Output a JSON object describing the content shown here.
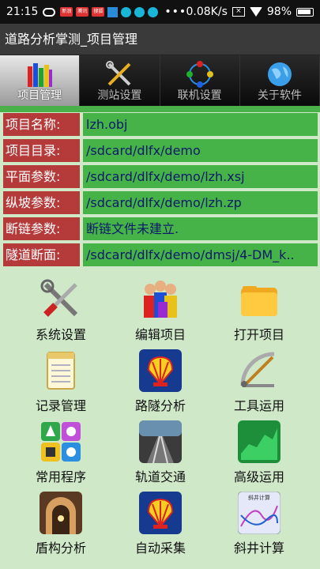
{
  "status": {
    "time": "21:15",
    "speed": "0.08K/s",
    "battery": "98%",
    "badges": [
      "新浪",
      "腾讯",
      "搜狐"
    ]
  },
  "title": "道路分析掌测_项目管理",
  "tabs": [
    {
      "label": "项目管理",
      "icon": "books-icon"
    },
    {
      "label": "测站设置",
      "icon": "tools-icon"
    },
    {
      "label": "联机设置",
      "icon": "network-icon"
    },
    {
      "label": "关于软件",
      "icon": "globe-icon"
    }
  ],
  "info": [
    {
      "label": "项目名称:",
      "value": "lzh.obj"
    },
    {
      "label": "项目目录:",
      "value": "/sdcard/dlfx/demo"
    },
    {
      "label": "平面参数:",
      "value": "/sdcard/dlfx/demo/lzh.xsj"
    },
    {
      "label": "纵坡参数:",
      "value": "/sdcard/dlfx/demo/lzh.zp"
    },
    {
      "label": "断链参数:",
      "value": "断链文件未建立."
    },
    {
      "label": "隧道断面:",
      "value": "/sdcard/dlfx/demo/dmsj/4-DM_k.."
    }
  ],
  "grid": [
    {
      "label": "系统设置",
      "icon": "wrench-screwdriver-icon"
    },
    {
      "label": "编辑项目",
      "icon": "people-icon"
    },
    {
      "label": "打开项目",
      "icon": "folder-icon"
    },
    {
      "label": "记录管理",
      "icon": "notepad-icon"
    },
    {
      "label": "路隧分析",
      "icon": "shell-logo-icon"
    },
    {
      "label": "工具运用",
      "icon": "protractor-icon"
    },
    {
      "label": "常用程序",
      "icon": "apps-icon"
    },
    {
      "label": "轨道交通",
      "icon": "railway-icon"
    },
    {
      "label": "高级运用",
      "icon": "green-chart-icon"
    },
    {
      "label": "盾构分析",
      "icon": "tunnel-icon"
    },
    {
      "label": "自动采集",
      "icon": "shell-logo-icon"
    },
    {
      "label": "斜井计算",
      "icon": "curve-graph-icon"
    }
  ],
  "grid_caption": "斜井计算"
}
